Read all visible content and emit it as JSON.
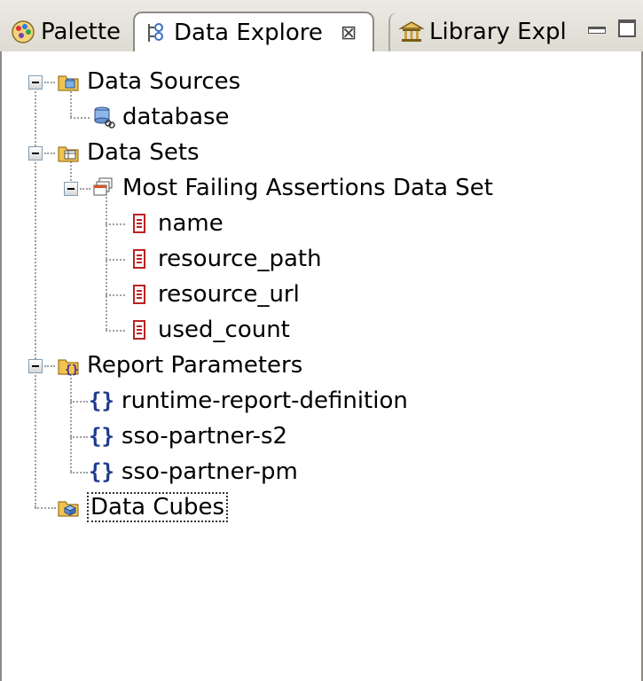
{
  "tabs": [
    {
      "label": "Palette",
      "icon": "palette-icon"
    },
    {
      "label": "Data Explore",
      "icon": "data-explorer-icon",
      "close": "⊠",
      "active": true
    },
    {
      "label": "Library Expl",
      "icon": "library-icon"
    }
  ],
  "tree": {
    "data_sources": {
      "label": "Data Sources",
      "children": [
        "database"
      ]
    },
    "data_sets": {
      "label": "Data Sets",
      "dataset": {
        "label": "Most Failing Assertions Data Set",
        "columns": [
          "name",
          "resource_path",
          "resource_url",
          "used_count"
        ]
      }
    },
    "report_parameters": {
      "label": "Report Parameters",
      "param_icon": "{}",
      "children": [
        "runtime-report-definition",
        "sso-partner-s2",
        "sso-partner-pm"
      ]
    },
    "data_cubes": {
      "label": "Data Cubes",
      "selected": true
    }
  },
  "colors": {
    "tab_bg": "#dedbd2",
    "tree_line": "#a0a0a0",
    "folder": "#e8b54a",
    "column_icon": "#c0392b",
    "param_icon": "#1d3b8f"
  }
}
